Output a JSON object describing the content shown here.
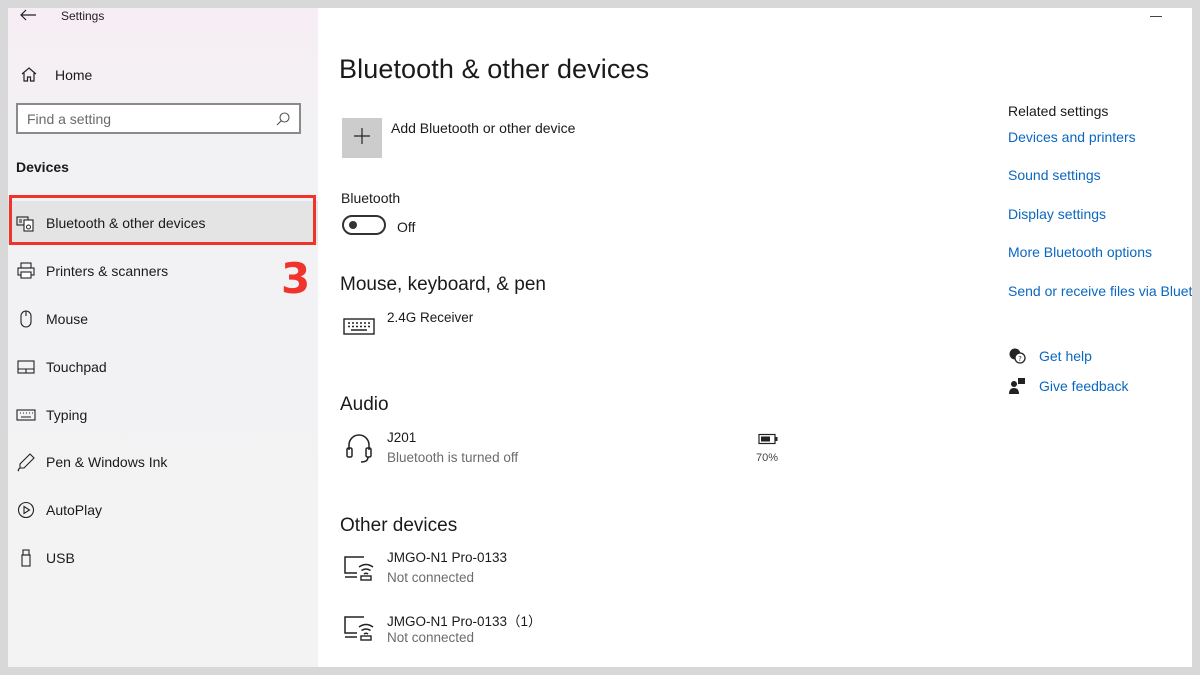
{
  "window": {
    "title": "Settings"
  },
  "sidebar": {
    "home_label": "Home",
    "search_placeholder": "Find a setting",
    "section_title": "Devices",
    "items": [
      {
        "label": "Bluetooth & other devices",
        "icon": "bluetooth-devices-icon",
        "selected": true
      },
      {
        "label": "Printers & scanners",
        "icon": "printer-icon"
      },
      {
        "label": "Mouse",
        "icon": "mouse-icon"
      },
      {
        "label": "Touchpad",
        "icon": "touchpad-icon"
      },
      {
        "label": "Typing",
        "icon": "keyboard-icon"
      },
      {
        "label": "Pen & Windows Ink",
        "icon": "pen-icon"
      },
      {
        "label": "AutoPlay",
        "icon": "autoplay-icon"
      },
      {
        "label": "USB",
        "icon": "usb-icon"
      }
    ]
  },
  "annotation": {
    "step": "3",
    "color": "#f0342b"
  },
  "main": {
    "title": "Bluetooth & other devices",
    "add_device_label": "Add Bluetooth or other device",
    "bluetooth_label": "Bluetooth",
    "bluetooth_state": "Off",
    "groups": {
      "mouse": {
        "title": "Mouse, keyboard, & pen",
        "devices": [
          {
            "name": "2.4G Receiver",
            "icon": "keyboard-icon"
          }
        ]
      },
      "audio": {
        "title": "Audio",
        "devices": [
          {
            "name": "J201",
            "status": "Bluetooth is turned off",
            "icon": "headset-icon",
            "battery": "70%"
          }
        ]
      },
      "other": {
        "title": "Other devices",
        "devices": [
          {
            "name": "JMGO-N1 Pro-0133",
            "status": "Not connected",
            "icon": "wireless-display-icon"
          },
          {
            "name": "JMGO-N1 Pro-0133（1）",
            "status": "Not connected",
            "icon": "wireless-display-icon"
          }
        ]
      }
    }
  },
  "related": {
    "title": "Related settings",
    "links": [
      "Devices and printers",
      "Sound settings",
      "Display settings",
      "More Bluetooth options",
      "Send or receive files via Blueto"
    ],
    "help_label": "Get help",
    "feedback_label": "Give feedback"
  },
  "colors": {
    "accent": "#0a67c1",
    "highlight": "#f0342b"
  }
}
